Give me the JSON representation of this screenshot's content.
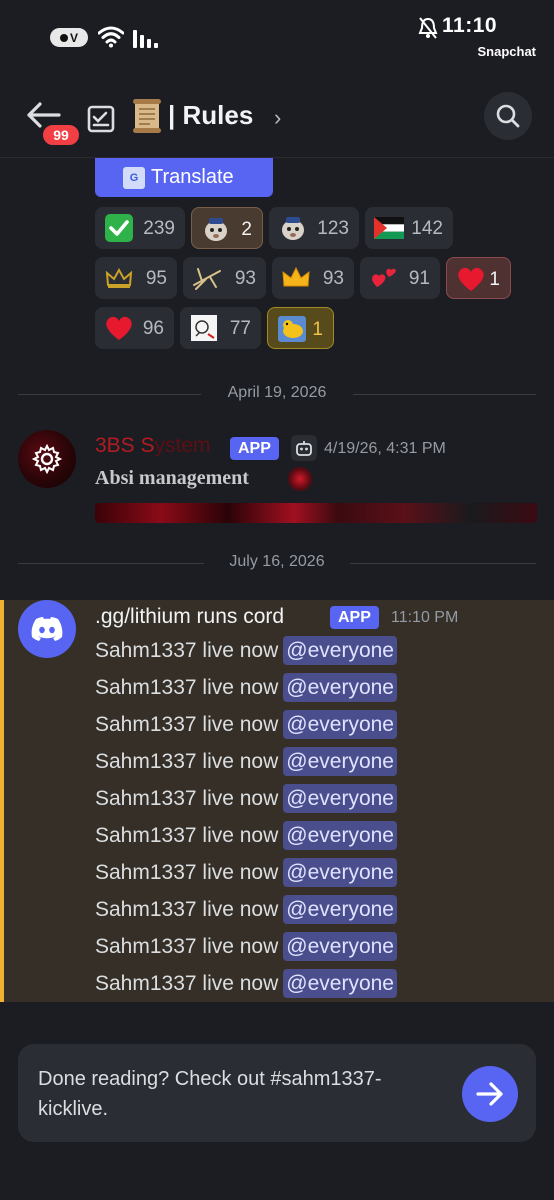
{
  "status_bar": {
    "pill_text": "V",
    "clock": "11:10",
    "notification_app": "Snapchat"
  },
  "header": {
    "unread_badge": "99",
    "channel_title": "| Rules",
    "chevron": "›"
  },
  "translate_button": {
    "label": "Translate",
    "icon_text": "G"
  },
  "reactions": [
    {
      "emoji": "check-mark",
      "count": "239"
    },
    {
      "emoji": "cat-meme-1",
      "count": "2"
    },
    {
      "emoji": "cat-meme-2",
      "count": "123"
    },
    {
      "emoji": "palestine-flag",
      "count": "142"
    },
    {
      "emoji": "crown-outline",
      "count": "95"
    },
    {
      "emoji": "plane",
      "count": "93"
    },
    {
      "emoji": "crown-gold",
      "count": "93"
    },
    {
      "emoji": "hearts",
      "count": "91"
    },
    {
      "emoji": "red-heart",
      "count": "1"
    },
    {
      "emoji": "red-heart",
      "count": "96"
    },
    {
      "emoji": "sticker-sketch",
      "count": "77"
    },
    {
      "emoji": "yellow-bird",
      "count": "1"
    }
  ],
  "dividers": {
    "first": "April 19, 2026",
    "second": "July 16, 2026"
  },
  "message1": {
    "author_main": "3BS S",
    "author_faded": "ystem",
    "app_tag": "APP",
    "timestamp": "4/19/26, 4:31 PM",
    "body": "Absi management"
  },
  "message2": {
    "author": ".gg/lithium runs cord",
    "app_tag": "APP",
    "timestamp": "11:10 PM",
    "lines": [
      {
        "text": "Sahm1337 live now",
        "mention": "@everyone"
      },
      {
        "text": "Sahm1337 live now",
        "mention": "@everyone"
      },
      {
        "text": "Sahm1337 live now",
        "mention": "@everyone"
      },
      {
        "text": "Sahm1337 live now",
        "mention": "@everyone"
      },
      {
        "text": "Sahm1337 live now",
        "mention": "@everyone"
      },
      {
        "text": "Sahm1337 live now",
        "mention": "@everyone"
      },
      {
        "text": "Sahm1337 live now",
        "mention": "@everyone"
      },
      {
        "text": "Sahm1337 live now",
        "mention": "@everyone"
      },
      {
        "text": "Sahm1337 live now",
        "mention": "@everyone"
      },
      {
        "text": "Sahm1337 live now",
        "mention": "@everyone"
      }
    ]
  },
  "done_card": {
    "text": "Done reading? Check out #sahm1337-kicklive."
  },
  "colors": {
    "background": "#1c1d23",
    "blurple": "#5865f2",
    "mention_highlight": "#352f27",
    "mention_bar": "#f0b232",
    "badge_red": "#f23f43"
  }
}
